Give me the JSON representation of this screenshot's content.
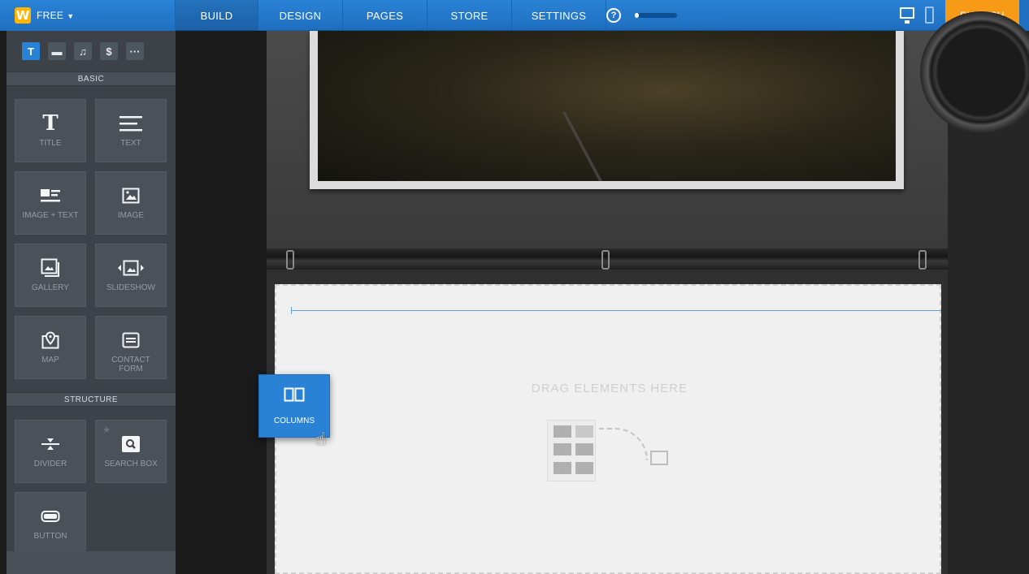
{
  "topbar": {
    "logo_letter": "W",
    "plan_label": "FREE",
    "nav": [
      {
        "label": "BUILD",
        "active": true
      },
      {
        "label": "DESIGN"
      },
      {
        "label": "PAGES"
      },
      {
        "label": "STORE"
      },
      {
        "label": "SETTINGS"
      }
    ],
    "help_label": "?",
    "progress_fraction": 0.1,
    "publish_label": "PUBLISH",
    "icons": [
      "weebly-logo-icon",
      "chevron-down-icon",
      "help-icon",
      "desktop-icon",
      "mobile-icon"
    ]
  },
  "sidebar": {
    "tabs": [
      {
        "glyph": "T",
        "name": "text-tab-icon",
        "active": true
      },
      {
        "glyph": "▬",
        "name": "layout-tab-icon"
      },
      {
        "glyph": "♫",
        "name": "media-tab-icon"
      },
      {
        "glyph": "$",
        "name": "commerce-tab-icon"
      },
      {
        "glyph": "···",
        "name": "more-tab-icon"
      }
    ],
    "basic_header": "BASIC",
    "basic_items": [
      {
        "label": "TITLE",
        "icon": "title-icon"
      },
      {
        "label": "TEXT",
        "icon": "text-icon"
      },
      {
        "label": "IMAGE + TEXT",
        "icon": "image-text-icon"
      },
      {
        "label": "IMAGE",
        "icon": "image-icon"
      },
      {
        "label": "GALLERY",
        "icon": "gallery-icon"
      },
      {
        "label": "SLIDESHOW",
        "icon": "slideshow-icon"
      },
      {
        "label": "MAP",
        "icon": "map-icon"
      },
      {
        "label": "CONTACT FORM",
        "icon": "contact-form-icon"
      }
    ],
    "structure_header": "STRUCTURE",
    "structure_items": [
      {
        "label": "DIVIDER",
        "icon": "divider-icon"
      },
      {
        "label": "SEARCH BOX",
        "icon": "search-box-icon"
      },
      {
        "label": "BUTTON",
        "icon": "button-icon"
      }
    ]
  },
  "canvas": {
    "drop_hint": "DRAG ELEMENTS HERE"
  },
  "dragging": {
    "label": "COLUMNS",
    "icon": "columns-icon"
  },
  "colors": {
    "accent": "#2a82d6",
    "publish": "#f79a15",
    "sidebar_bg": "#3c4248"
  }
}
